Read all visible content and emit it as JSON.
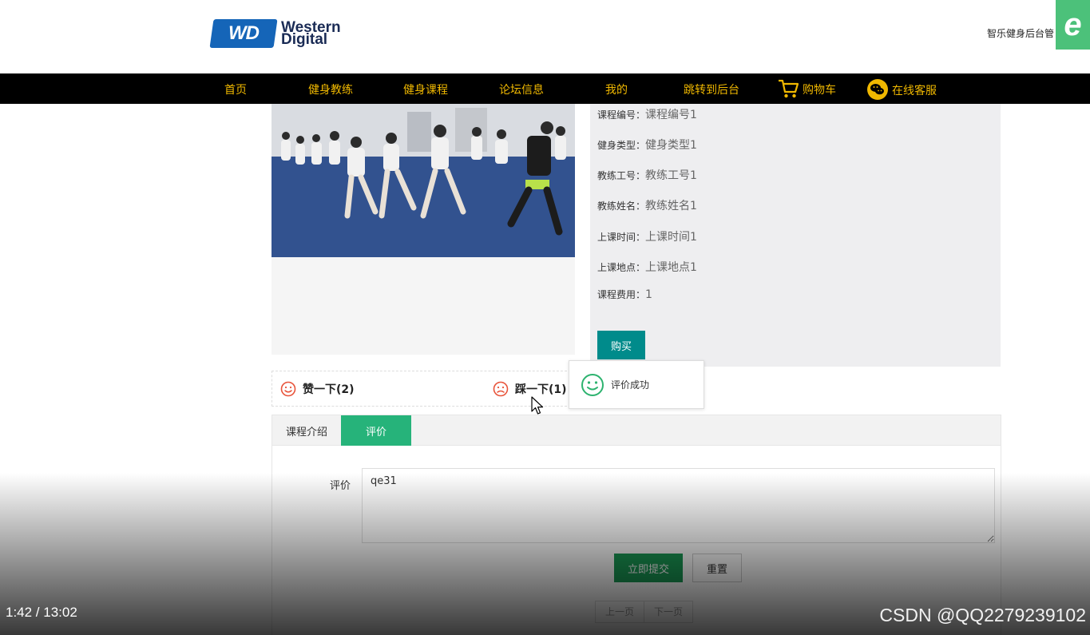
{
  "header": {
    "logo_line1": "Western",
    "logo_line2": "Digital",
    "logo_mark": "WD",
    "right_text": "智乐健身后台管",
    "corner_badge": "e"
  },
  "nav": {
    "items": [
      "首页",
      "健身教练",
      "健身课程",
      "论坛信息",
      "我的",
      "跳转到后台"
    ],
    "cart_label": "购物车",
    "service_label": "在线客服",
    "cart_icon": "cart-icon",
    "service_icon": "wechat-icon",
    "text_color": "#f0b800"
  },
  "course": {
    "fields": [
      {
        "label": "课程编号：",
        "value": "课程编号1"
      },
      {
        "label": "健身类型：",
        "value": "健身类型1"
      },
      {
        "label": "教练工号：",
        "value": "教练工号1"
      },
      {
        "label": "教练姓名：",
        "value": "教练姓名1"
      },
      {
        "label": "上课时间：",
        "value": "上课时间1"
      },
      {
        "label": "上课地点：",
        "value": "上课地点1"
      },
      {
        "label": "课程费用：",
        "value": "1"
      }
    ],
    "buy_label": "购买"
  },
  "votes": {
    "like_label": "赞一下(2)",
    "dislike_label": "踩一下(1)"
  },
  "toast": {
    "message": "评价成功"
  },
  "tabs": {
    "items": [
      "课程介绍",
      "评价"
    ],
    "active": "评价"
  },
  "review_form": {
    "label": "评价",
    "value": "qe31",
    "submit_label": "立即提交",
    "reset_label": "重置",
    "prev_label": "上一页",
    "next_label": "下一页"
  },
  "video": {
    "timecode": "1:42 / 13:02",
    "watermark": "CSDN @QQ2279239102"
  },
  "colors": {
    "buy_button": "#008b8b",
    "active_tab": "#26b37a",
    "submit_button": "#1a9a55",
    "toast_icon": "#2db36f",
    "vote_icon": "#e8533a"
  }
}
